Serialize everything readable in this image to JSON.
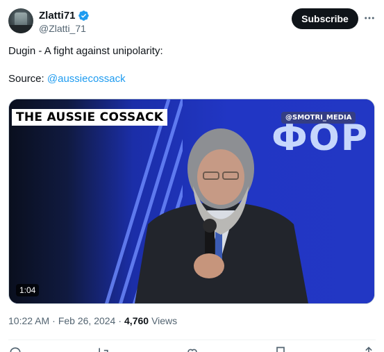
{
  "tweet": {
    "author": {
      "display_name": "Zlatti71",
      "handle": "@Zlatti_71",
      "verified_icon": "verified-badge-icon"
    },
    "subscribe_label": "Subscribe",
    "more_icon": "more-horizontal-icon",
    "text_line1": "Dugin - A fight against unipolarity:",
    "source_label": "Source: ",
    "source_link": "@aussiecossack",
    "media": {
      "caption": "THE AUSSIE COSSACK",
      "watermark": "@SMOTRI_MEDIA",
      "background_letters": "ФОР",
      "duration": "1:04"
    },
    "time": "10:22 AM",
    "separator": "·",
    "date": "Feb 26, 2024",
    "views_count": "4,760",
    "views_label": "Views"
  },
  "colors": {
    "link": "#1d9bf0",
    "subscribe_bg": "#0f1419",
    "verified": "#1d9bf0",
    "secondary_text": "#536471"
  },
  "action_icons": [
    "reply-icon",
    "retweet-icon",
    "like-icon",
    "bookmark-icon",
    "share-icon"
  ]
}
